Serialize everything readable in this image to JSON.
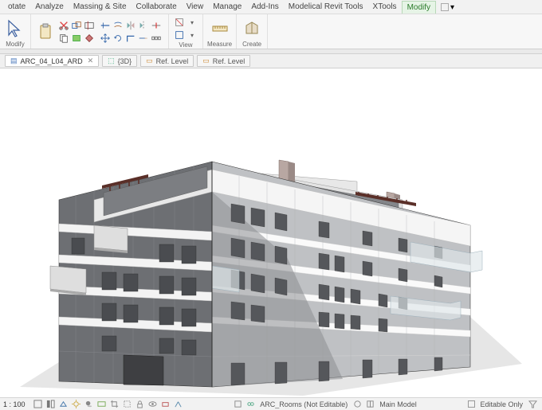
{
  "menu": {
    "tabs": [
      "otate",
      "Analyze",
      "Massing & Site",
      "Collaborate",
      "View",
      "Manage",
      "Add-Ins",
      "Modelical Revit Tools",
      "XTools",
      "Modify"
    ],
    "active_index": 9
  },
  "ribbon": {
    "groups": [
      {
        "title": "Modify"
      },
      {
        "title": ""
      },
      {
        "title": "View"
      },
      {
        "title": "Measure"
      },
      {
        "title": "Create"
      }
    ]
  },
  "doctabs": {
    "file": "ARC_04_L04_ARD",
    "t3d": "{3D}",
    "ref1": "Ref. Level",
    "ref2": "Ref. Level"
  },
  "status": {
    "scale": "1 : 100",
    "center": "ARC_Rooms (Not Editable)",
    "mainmodel": "Main Model",
    "editable": "Editable Only"
  }
}
